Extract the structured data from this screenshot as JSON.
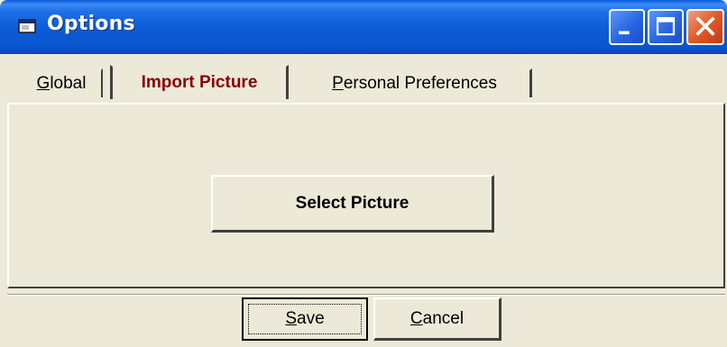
{
  "window": {
    "title": "Options",
    "title_icon": "window-app-icon",
    "controls": [
      "minimize-icon",
      "maximize-icon",
      "close-icon"
    ]
  },
  "tabs": [
    {
      "label_mnemonic": "G",
      "label_rest": "lobal",
      "active": false
    },
    {
      "label_mnemonic": "",
      "label_rest": "Import Picture",
      "active": true
    },
    {
      "label_mnemonic": "P",
      "label_rest": "ersonal Preferences",
      "active": false
    }
  ],
  "panel": {
    "select_picture_label": "Select Picture"
  },
  "footer": {
    "save_mnemonic": "S",
    "save_rest": "ave",
    "cancel_mnemonic": "C",
    "cancel_rest": "ancel"
  },
  "colors": {
    "titlebar": "#0b5bd6",
    "active_tab_text": "#8b0000",
    "dialog_bg": "#ece9d8",
    "close_button": "#e05a2a"
  }
}
